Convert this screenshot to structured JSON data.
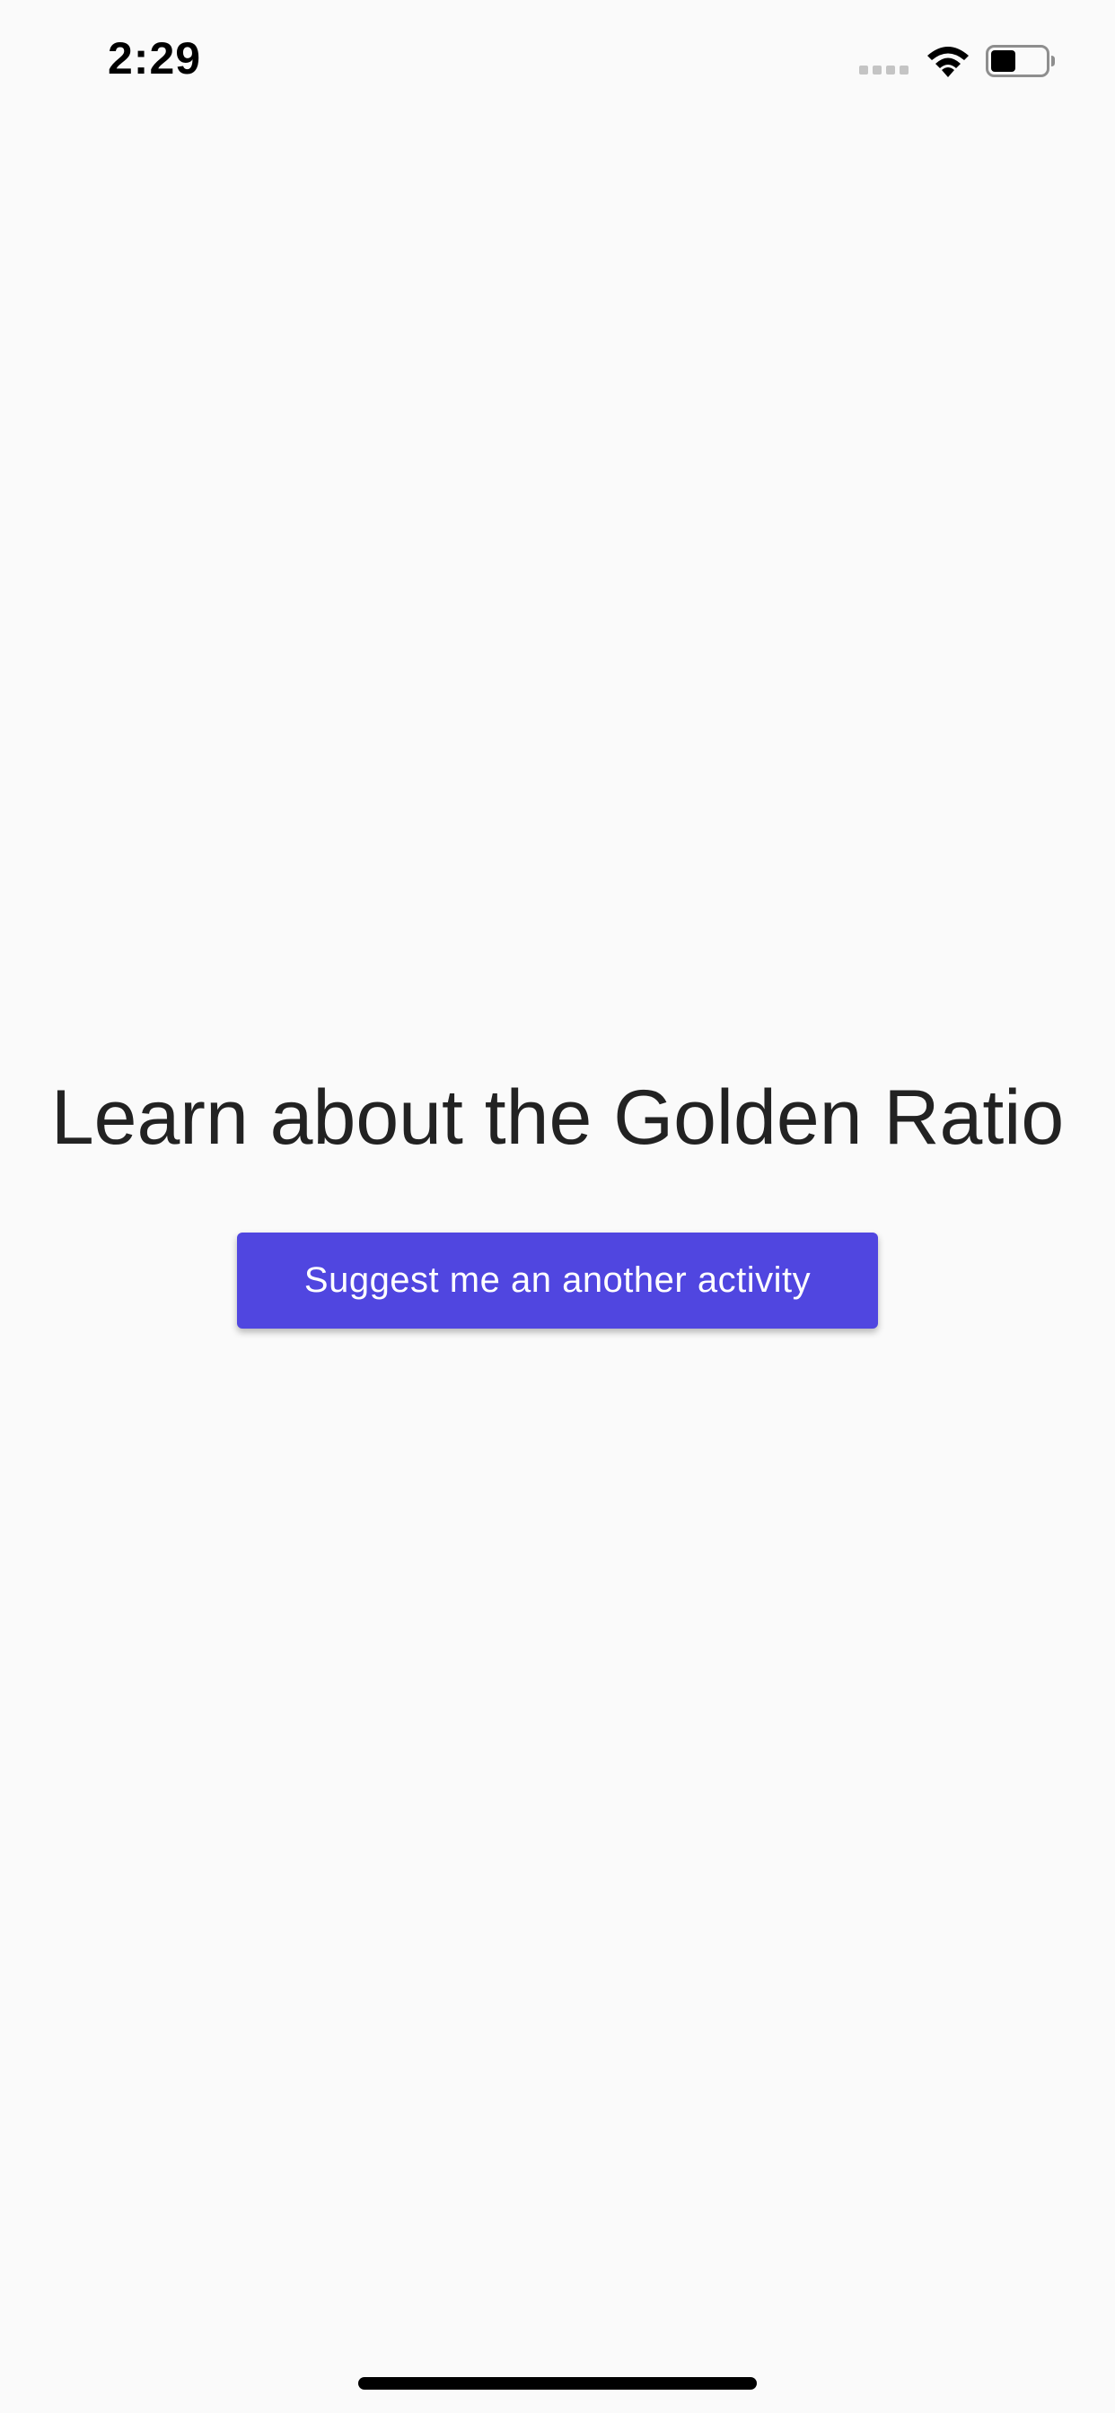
{
  "status_bar": {
    "time": "2:29",
    "signal_icon": "cellular-signal-icon",
    "wifi_icon": "wifi-icon",
    "battery_icon": "battery-icon",
    "battery_level": 0.45
  },
  "main": {
    "title": "Learn about the Golden Ratio",
    "button_label": "Suggest me an another activity"
  },
  "colors": {
    "background": "#fafafa",
    "title_text": "#222222",
    "button_background": "#5046e0",
    "button_text": "#ffffff"
  }
}
